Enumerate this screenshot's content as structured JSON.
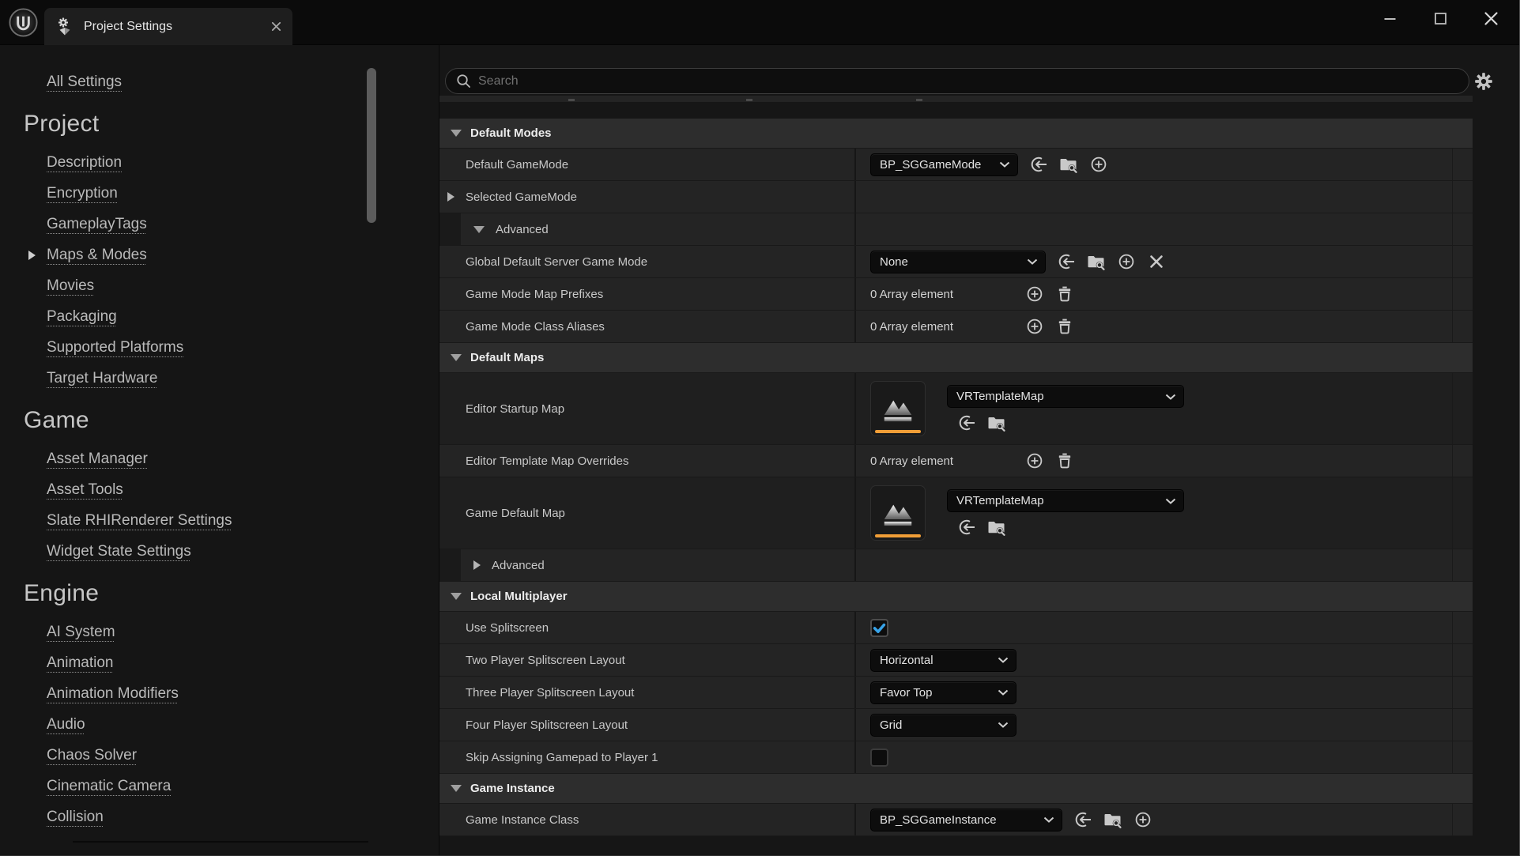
{
  "window": {
    "tab_title": "Project Settings",
    "controls": {
      "minimize": "minimize",
      "maximize": "maximize",
      "close": "close"
    }
  },
  "search": {
    "placeholder": "Search"
  },
  "sidebar": {
    "all_settings": "All Settings",
    "sections": [
      {
        "title": "Project",
        "items": [
          "Description",
          "Encryption",
          "GameplayTags",
          "Maps & Modes",
          "Movies",
          "Packaging",
          "Supported Platforms",
          "Target Hardware"
        ],
        "selected_item": "Maps & Modes"
      },
      {
        "title": "Game",
        "items": [
          "Asset Manager",
          "Asset Tools",
          "Slate RHIRenderer Settings",
          "Widget State Settings"
        ]
      },
      {
        "title": "Engine",
        "items": [
          "AI System",
          "Animation",
          "Animation Modifiers",
          "Audio",
          "Chaos Solver",
          "Cinematic Camera",
          "Collision"
        ]
      }
    ]
  },
  "panel": {
    "headers": {
      "default_modes": "Default Modes",
      "default_maps": "Default Maps",
      "local_multiplayer": "Local Multiplayer",
      "game_instance": "Game Instance"
    },
    "rows": {
      "default_gamemode": {
        "label": "Default GameMode",
        "value": "BP_SGGameMode"
      },
      "selected_gamemode": {
        "label": "Selected GameMode"
      },
      "advanced_modes": {
        "label": "Advanced",
        "expanded": true
      },
      "global_default_server_game_mode": {
        "label": "Global Default Server Game Mode",
        "value": "None"
      },
      "game_mode_map_prefixes": {
        "label": "Game Mode Map Prefixes",
        "value": "0 Array element"
      },
      "game_mode_class_aliases": {
        "label": "Game Mode Class Aliases",
        "value": "0 Array element"
      },
      "editor_startup_map": {
        "label": "Editor Startup Map",
        "value": "VRTemplateMap"
      },
      "editor_template_map_overrides": {
        "label": "Editor Template Map Overrides",
        "value": "0 Array element"
      },
      "game_default_map": {
        "label": "Game Default Map",
        "value": "VRTemplateMap"
      },
      "advanced_maps": {
        "label": "Advanced",
        "expanded": false
      },
      "use_splitscreen": {
        "label": "Use Splitscreen",
        "checked": true
      },
      "two_player_splitscreen_layout": {
        "label": "Two Player Splitscreen Layout",
        "value": "Horizontal"
      },
      "three_player_splitscreen_layout": {
        "label": "Three Player Splitscreen Layout",
        "value": "Favor Top"
      },
      "four_player_splitscreen_layout": {
        "label": "Four Player Splitscreen Layout",
        "value": "Grid"
      },
      "skip_assigning_gamepad": {
        "label": "Skip Assigning Gamepad to Player 1",
        "checked": false
      },
      "game_instance_class": {
        "label": "Game Instance Class",
        "value": "BP_SGGameInstance"
      }
    }
  },
  "icons": {
    "search": "magnifier",
    "settings_gear": "gear",
    "use_selected_asset": "circle-with-left-arrow",
    "browse_to_asset": "folder-with-magnifier",
    "add": "plus-in-circle",
    "clear": "x-cross",
    "delete": "trash-can",
    "dropdown": "chevron-down",
    "map_thumbnail": "mountains-with-orange-bar",
    "checkbox_check": "blue-checkmark"
  },
  "colors": {
    "accent_orange": "#F19E37",
    "check_blue": "#38A3E8",
    "row_bg": "#242424",
    "section_header_bg": "#2D2D2D",
    "titlebar_bg": "#0B0B0B"
  }
}
